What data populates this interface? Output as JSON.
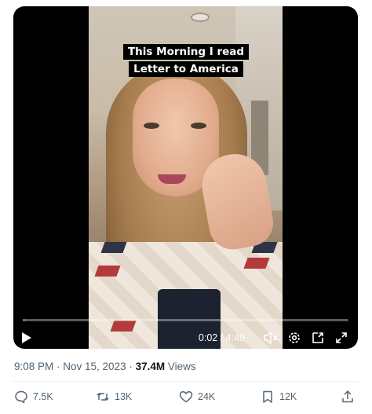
{
  "video": {
    "caption": "This Morning I read Letter to America",
    "time": "0:02 / 4:49",
    "progress": 0.007
  },
  "meta": {
    "timestamp": "9:08 PM · Nov 15, 2023 · ",
    "views_count": "37.4M",
    "views_label": " Views"
  },
  "actions": {
    "replies": "7.5K",
    "reposts": "13K",
    "likes": "24K",
    "bookmarks": "12K"
  },
  "colors": {
    "accent": "#1d9bf0",
    "secondary_text": "#536471"
  }
}
